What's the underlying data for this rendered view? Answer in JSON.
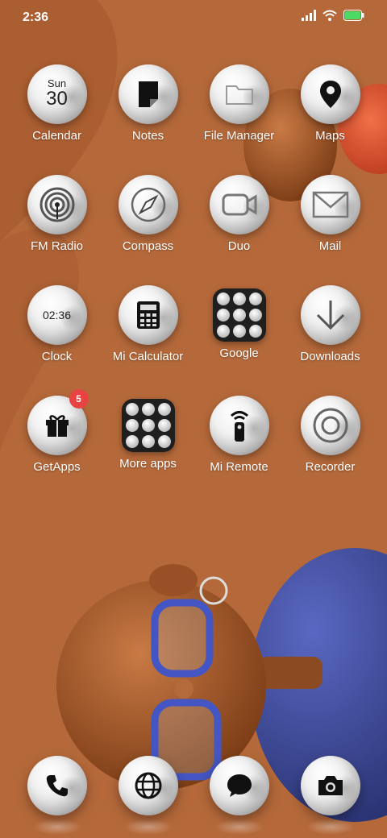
{
  "status": {
    "time": "2:36",
    "icons": [
      "signal-icon",
      "wifi-icon",
      "battery-icon"
    ],
    "battery_color": "#4cd964"
  },
  "calendar": {
    "day": "Sun",
    "date": "30"
  },
  "clock": {
    "time": "02:36"
  },
  "apps": [
    {
      "label": "Calendar",
      "icon": "calendar-icon"
    },
    {
      "label": "Notes",
      "icon": "notes-icon"
    },
    {
      "label": "File Manager",
      "icon": "folder-icon"
    },
    {
      "label": "Maps",
      "icon": "map-pin-icon"
    },
    {
      "label": "FM Radio",
      "icon": "radio-icon"
    },
    {
      "label": "Compass",
      "icon": "compass-icon"
    },
    {
      "label": "Duo",
      "icon": "video-camera-icon"
    },
    {
      "label": "Mail",
      "icon": "mail-icon"
    },
    {
      "label": "Clock",
      "icon": "clock-icon"
    },
    {
      "label": "Mi Calculator",
      "icon": "calculator-icon"
    },
    {
      "label": "Google",
      "icon": "folder-grid-icon"
    },
    {
      "label": "Downloads",
      "icon": "download-icon"
    },
    {
      "label": "GetApps",
      "icon": "gift-icon",
      "badge": "5"
    },
    {
      "label": "More apps",
      "icon": "folder-grid-icon"
    },
    {
      "label": "Mi Remote",
      "icon": "remote-icon"
    },
    {
      "label": "Recorder",
      "icon": "record-icon"
    }
  ],
  "dock": [
    {
      "icon": "phone-icon"
    },
    {
      "icon": "globe-icon"
    },
    {
      "icon": "message-icon"
    },
    {
      "icon": "camera-icon"
    }
  ],
  "colors": {
    "wallpaper": "#b5693a",
    "badge": "#e74343",
    "accent_blue": "#3f4d9c",
    "accent_red": "#e0532f"
  }
}
